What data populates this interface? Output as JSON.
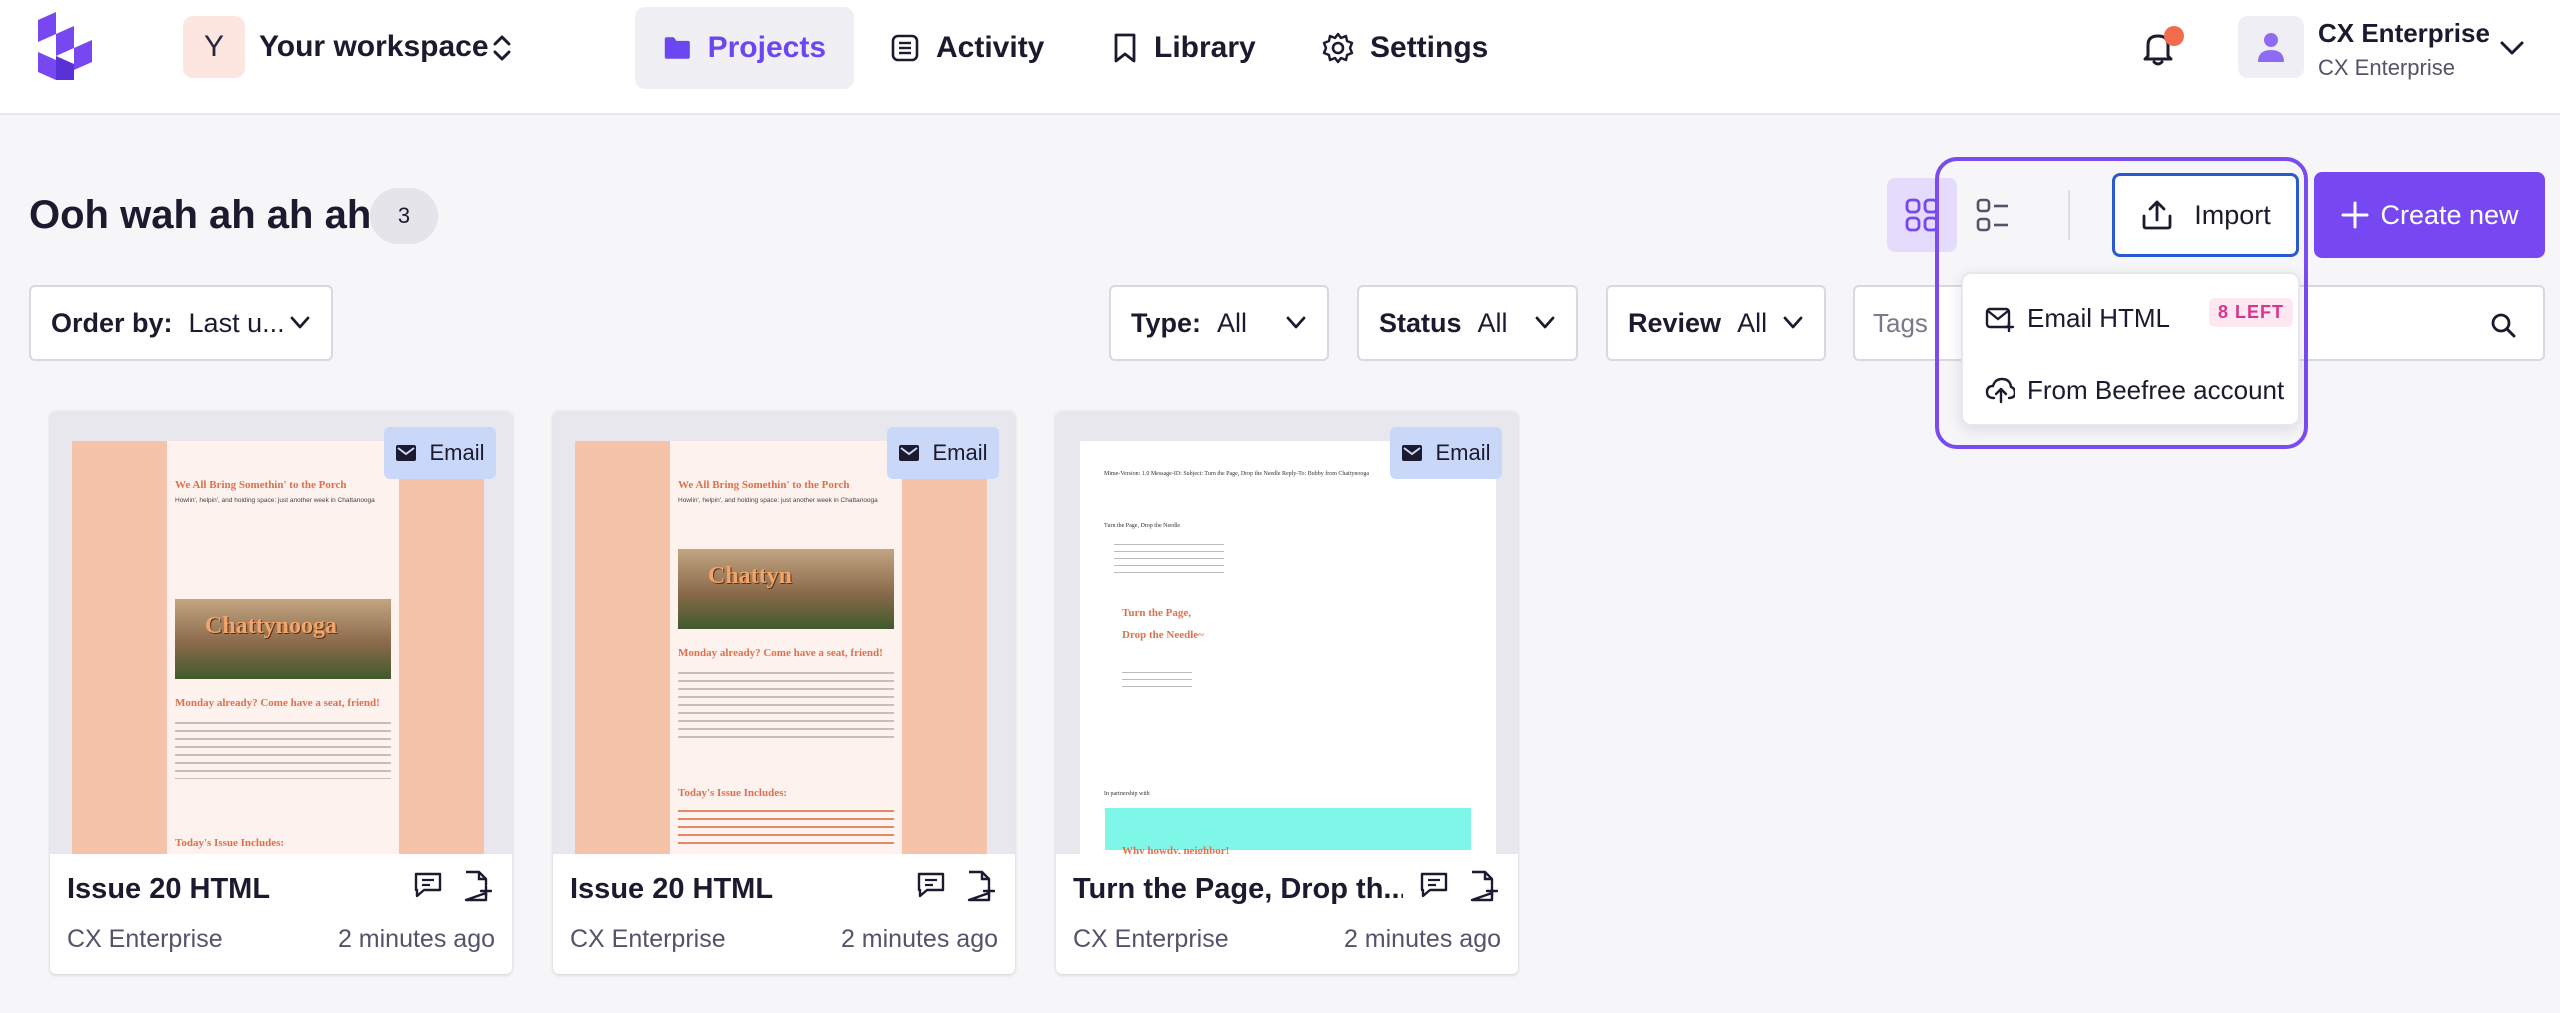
{
  "workspace": {
    "initial": "Y",
    "name": "Your workspace"
  },
  "nav": [
    {
      "label": "Projects",
      "icon": "folder-icon",
      "active": true
    },
    {
      "label": "Activity",
      "icon": "activity-list-icon",
      "active": false
    },
    {
      "label": "Library",
      "icon": "bookmark-icon",
      "active": false
    },
    {
      "label": "Settings",
      "icon": "gear-icon",
      "active": false
    }
  ],
  "user": {
    "name": "CX Enterprise",
    "org": "CX Enterprise"
  },
  "page": {
    "title": "Ooh wah ah ah ah",
    "count": "3"
  },
  "toolbar": {
    "import_label": "Import",
    "create_label": "Create new"
  },
  "import_menu": {
    "items": [
      {
        "label": "Email HTML",
        "badge": "8 LEFT"
      },
      {
        "label": "From Beefree account"
      }
    ]
  },
  "filters": {
    "order": {
      "label": "Order by:",
      "value": "Last u..."
    },
    "type": {
      "label": "Type:",
      "value": "All"
    },
    "status": {
      "label": "Status",
      "value": "All"
    },
    "review": {
      "label": "Review",
      "value": "All"
    },
    "tags_placeholder": "Tags"
  },
  "cards": [
    {
      "title": "Issue 20 HTML",
      "owner": "CX Enterprise",
      "time": "2 minutes ago",
      "tag": "Email",
      "preview": {
        "heading": "We All Bring Somethin' to the Porch",
        "subheading": "Howlin', helpin', and holding space: just another week in Chattanooga",
        "banner": "Chattynooga",
        "section": "Monday already? Come have a seat, friend!",
        "list_title": "Today's Issue Includes:"
      }
    },
    {
      "title": "Issue 20 HTML",
      "owner": "CX Enterprise",
      "time": "2 minutes ago",
      "tag": "Email",
      "preview": {
        "heading": "We All Bring Somethin' to the Porch",
        "subheading": "Howlin', helpin', and holding space: just another week in Chattanooga",
        "banner": "Chattyn",
        "section": "Monday already? Come have a seat, friend!",
        "list_title": "Today's Issue Includes:"
      }
    },
    {
      "title": "Turn the Page, Drop th...",
      "owner": "CX Enterprise",
      "time": "2 minutes ago",
      "tag": "Email",
      "preview": {
        "meta": "Mime-Version: 1.0 Message-ID: Subject: Turn the Page, Drop the Needle Reply-To: Bubby from Chattynooga",
        "crumb": "Turn the Page, Drop the Needle",
        "heading1": "Turn the Page,",
        "heading2": "Drop the Needle~",
        "partner": "In partnership with",
        "footer": "Why howdy, neighbor!"
      }
    }
  ],
  "colors": {
    "accent": "#7747f2",
    "import_border": "#2a5ad1",
    "highlight": "#7a4cf0",
    "badge_text": "#d6368c",
    "email_chip": "#c9d8f8"
  }
}
